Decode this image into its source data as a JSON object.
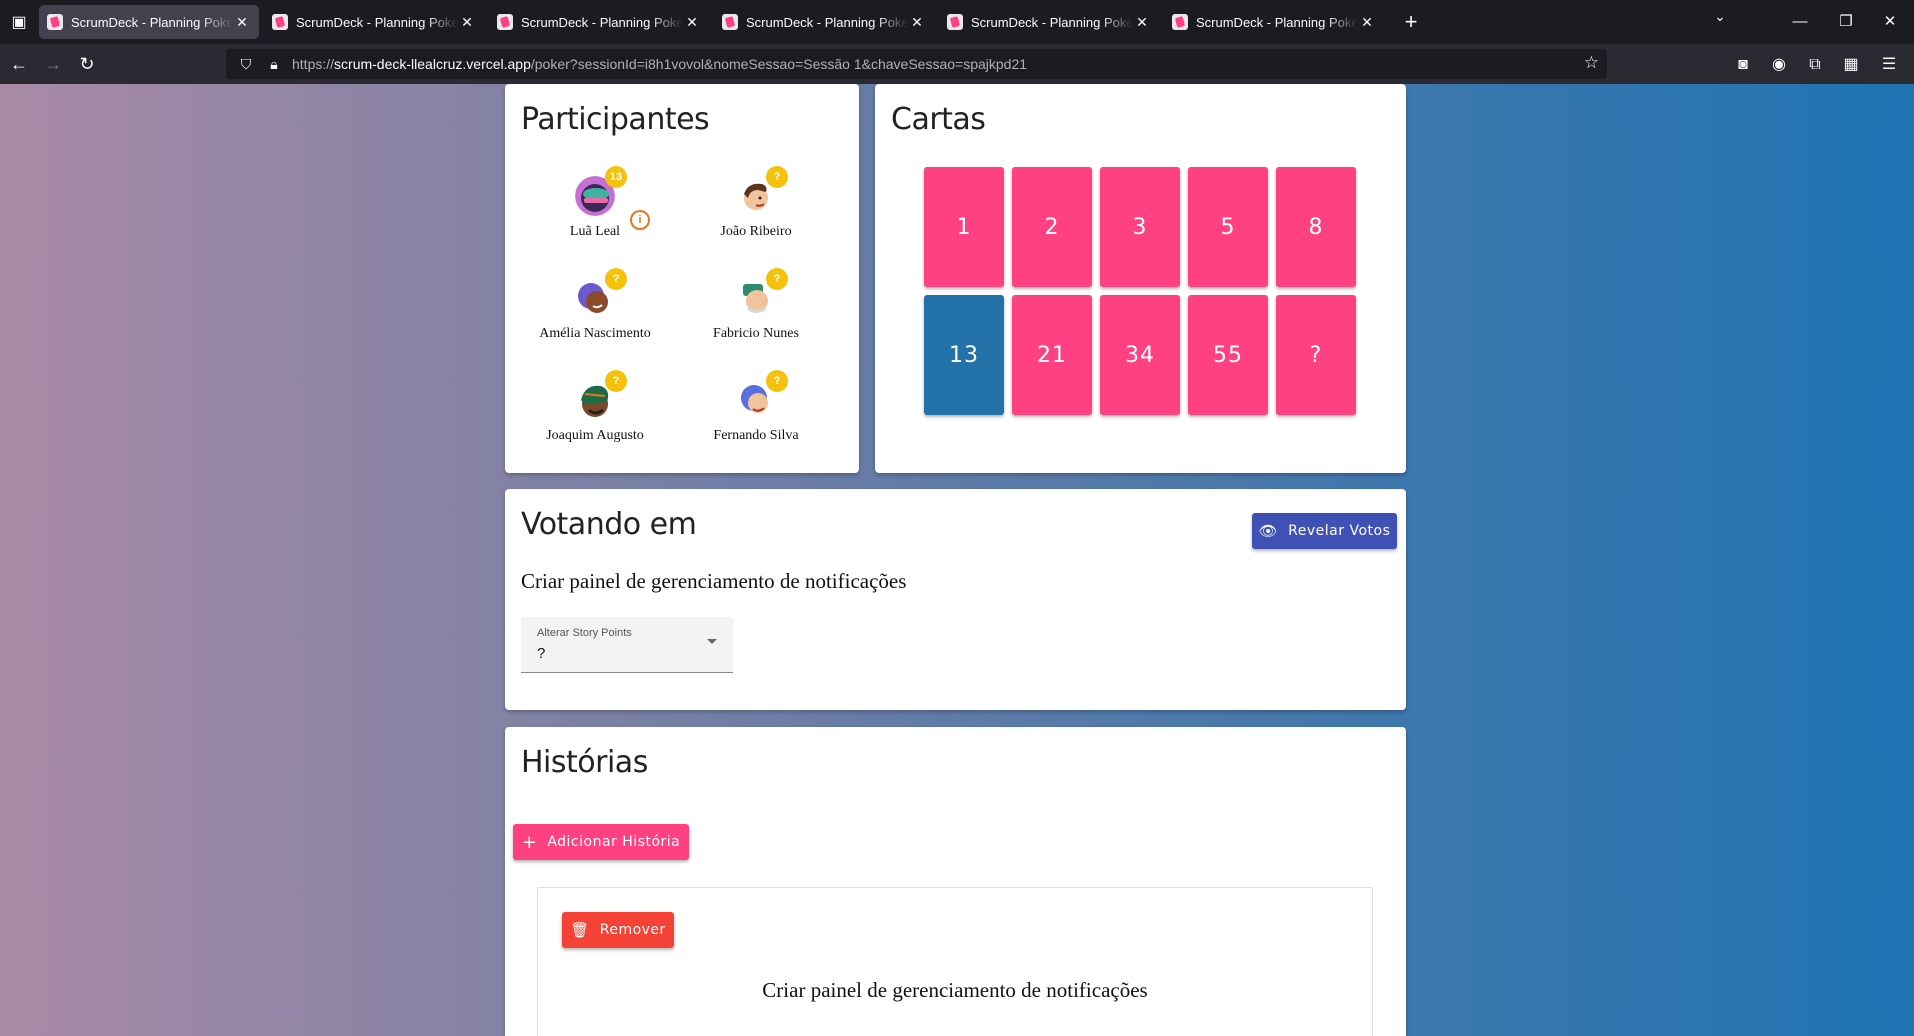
{
  "browser": {
    "tabs": [
      {
        "title": "ScrumDeck - Planning Poker para",
        "active": true
      },
      {
        "title": "ScrumDeck - Planning Poker para",
        "active": false
      },
      {
        "title": "ScrumDeck - Planning Poker para",
        "active": false
      },
      {
        "title": "ScrumDeck - Planning Poker para",
        "active": false
      },
      {
        "title": "ScrumDeck - Planning Poker para",
        "active": false
      },
      {
        "title": "ScrumDeck - Planning Poker para",
        "active": false
      }
    ],
    "url_prefix": "https://",
    "url_host": "scrum-deck-llealcruz.vercel.app",
    "url_path": "/poker?sessionId=i8h1vovol&nomeSessao=Sessão 1&chaveSessao=spajkpd21"
  },
  "participants": {
    "title": "Participantes",
    "items": [
      {
        "name": "Luã Leal",
        "badge": "13",
        "avatar": "avatar-lua-leal"
      },
      {
        "name": "João Ribeiro",
        "badge": "?",
        "avatar": "avatar-joao-ribeiro"
      },
      {
        "name": "Amélia Nascimento",
        "badge": "?",
        "avatar": "avatar-amelia-nascimento"
      },
      {
        "name": "Fabricio Nunes",
        "badge": "?",
        "avatar": "avatar-fabricio-nunes"
      },
      {
        "name": "Joaquim Augusto",
        "badge": "?",
        "avatar": "avatar-joaquim-augusto"
      },
      {
        "name": "Fernando Silva",
        "badge": "?",
        "avatar": "avatar-fernando-silva"
      }
    ]
  },
  "cards": {
    "title": "Cartas",
    "values": [
      "1",
      "2",
      "3",
      "5",
      "8",
      "13",
      "21",
      "34",
      "55",
      "?"
    ],
    "selected": "13"
  },
  "voting": {
    "title": "Votando em",
    "reveal_label": "Revelar Votos",
    "current_story": "Criar painel de gerenciamento de notificações",
    "select_label": "Alterar Story Points",
    "select_value": "?"
  },
  "stories": {
    "title": "Histórias",
    "add_label": "Adicionar História",
    "items": [
      {
        "remove_label": "Remover",
        "text": "Criar painel de gerenciamento de notificações"
      }
    ]
  },
  "colors": {
    "card_default": "#ff4081",
    "card_selected": "#2371a9",
    "reveal_button": "#3f51b5",
    "add_button": "#ff4081",
    "remove_button": "#f44336",
    "badge": "#f4c20d"
  }
}
